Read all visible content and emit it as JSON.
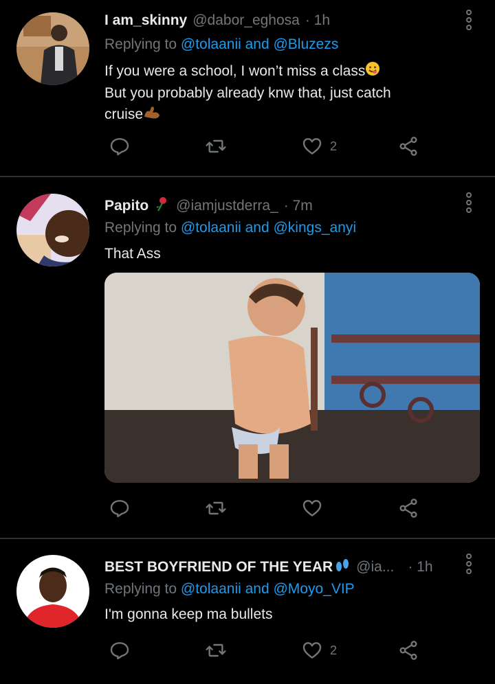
{
  "tweets": [
    {
      "name": "I am_skinny",
      "handle": "@dabor_eghosa",
      "time": "· 1h",
      "replying_prefix": "Replying to",
      "replying_links": "@tolaanii and @Bluzezs",
      "text_line1": "If you were a school, I won’t miss a class",
      "text_line2": "But you probably already knw that, just catch",
      "text_line3": "cruise",
      "likes": "2"
    },
    {
      "name": "Papito",
      "handle": "@iamjustderra_",
      "time": "· 7m",
      "replying_prefix": "Replying to",
      "replying_links": "@tolaanii and @kings_anyi",
      "text_line1": "That Ass"
    },
    {
      "name": "BEST BOYFRIEND OF THE YEAR",
      "handle": "@ia...",
      "time": "· 1h",
      "replying_prefix": "Replying to",
      "replying_links": "@tolaanii and @Moyo_VIP",
      "text_line1": "I'm gonna keep ma bullets",
      "likes": "2"
    }
  ],
  "colors": {
    "background": "#000000",
    "link": "#1d9bf0",
    "muted": "#71767b",
    "text": "#e7e9ea"
  }
}
